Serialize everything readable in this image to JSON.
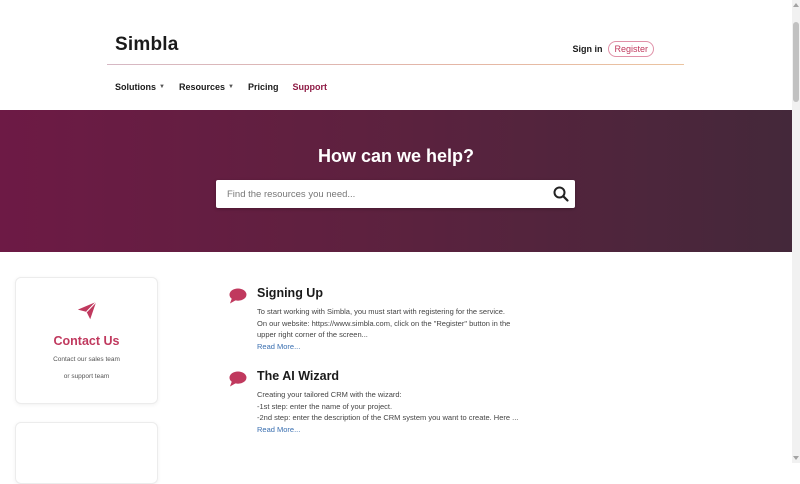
{
  "header": {
    "logo": "Simbla",
    "signin_label": "Sign in",
    "register_label": "Register"
  },
  "nav": {
    "items": [
      {
        "label": "Solutions",
        "has_caret": true
      },
      {
        "label": "Resources",
        "has_caret": true
      },
      {
        "label": "Pricing",
        "has_caret": false
      },
      {
        "label": "Support",
        "has_caret": false,
        "active": true
      }
    ]
  },
  "hero": {
    "title": "How can we help?",
    "search_placeholder": "Find the resources you need...",
    "search_icon": "search-icon"
  },
  "contact_card": {
    "icon": "paper-plane-icon",
    "title": "Contact Us",
    "line1": "Contact our sales team",
    "line2": "or support team"
  },
  "articles": [
    {
      "icon": "speech-bubble-icon",
      "title": "Signing Up",
      "lines": [
        "To start working with Simbla, you must start with registering for the service.",
        "On our website:  https://www.simbla.com, click on the \"Register\" button in the",
        "upper right corner of the screen..."
      ],
      "read_more": "Read More..."
    },
    {
      "icon": "speech-bubble-icon",
      "title": "The AI Wizard",
      "lines": [
        "Creating your tailored CRM with the wizard:",
        "-1st step: enter the name of your project.",
        "-2nd step: enter the description of the CRM system you want to create. Here ..."
      ],
      "read_more": "Read More..."
    }
  ],
  "colors": {
    "accent": "#c0395e",
    "active_nav": "#8e1a44",
    "hero_start": "#6d1a45",
    "hero_end": "#44283a",
    "link": "#3a6fb0"
  }
}
